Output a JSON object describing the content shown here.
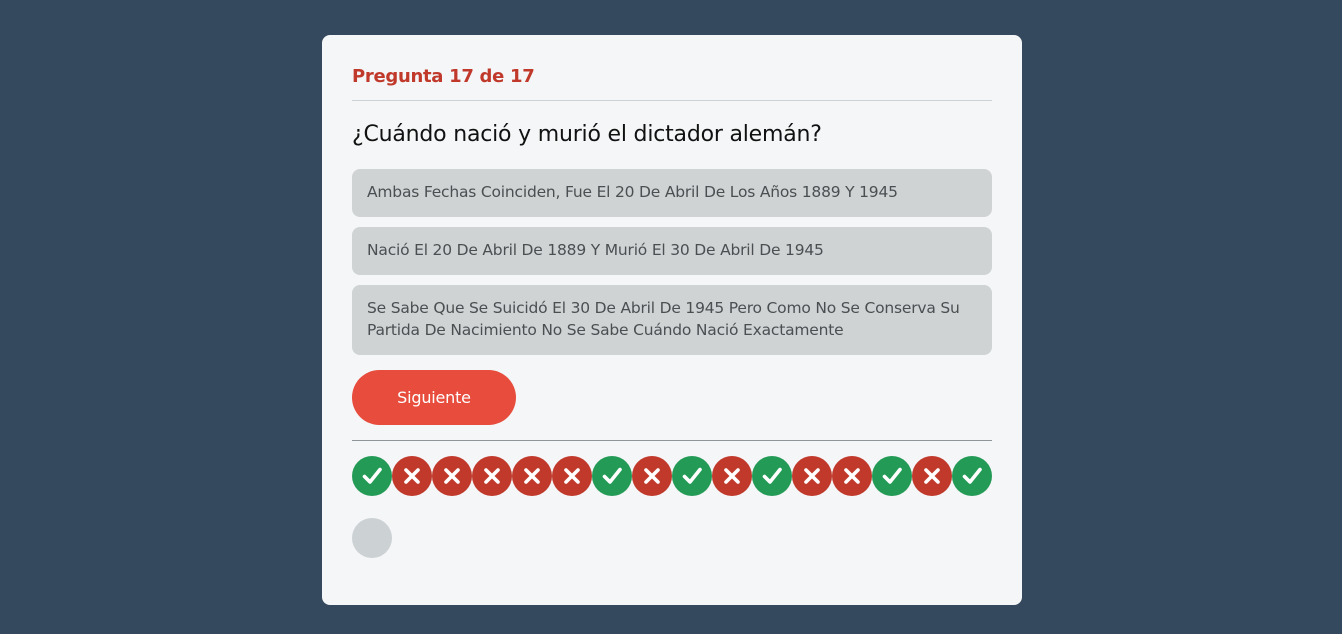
{
  "quiz": {
    "counter": "Pregunta 17 de 17",
    "question": "¿Cuándo nació y murió el dictador alemán?",
    "options": [
      "Ambas Fechas Coinciden, Fue El 20 De Abril De Los Años 1889 Y 1945",
      "Nació El 20 De Abril De 1889 Y Murió El 30 De Abril De 1945",
      "Se Sabe Que Se Suicidó El 30 De Abril De 1945 Pero Como No Se Conserva Su Partida De Nacimiento No Se Sabe Cuándo Nació Exactamente"
    ],
    "next_label": "Siguiente"
  },
  "progress": {
    "results": [
      "correct",
      "wrong",
      "wrong",
      "wrong",
      "wrong",
      "wrong",
      "correct",
      "wrong",
      "correct",
      "wrong",
      "correct",
      "wrong",
      "wrong",
      "correct",
      "wrong",
      "correct"
    ],
    "pending": 1,
    "icons": {
      "correct": "check-icon",
      "wrong": "cross-icon"
    }
  },
  "colors": {
    "background": "#34495e",
    "card": "#f4f6f7",
    "accent": "#e74c3c",
    "counter": "#c0392b",
    "correct": "#239b56",
    "wrong": "#c0392b",
    "pending": "#ccd1d4",
    "option": "#d0d3d4"
  }
}
